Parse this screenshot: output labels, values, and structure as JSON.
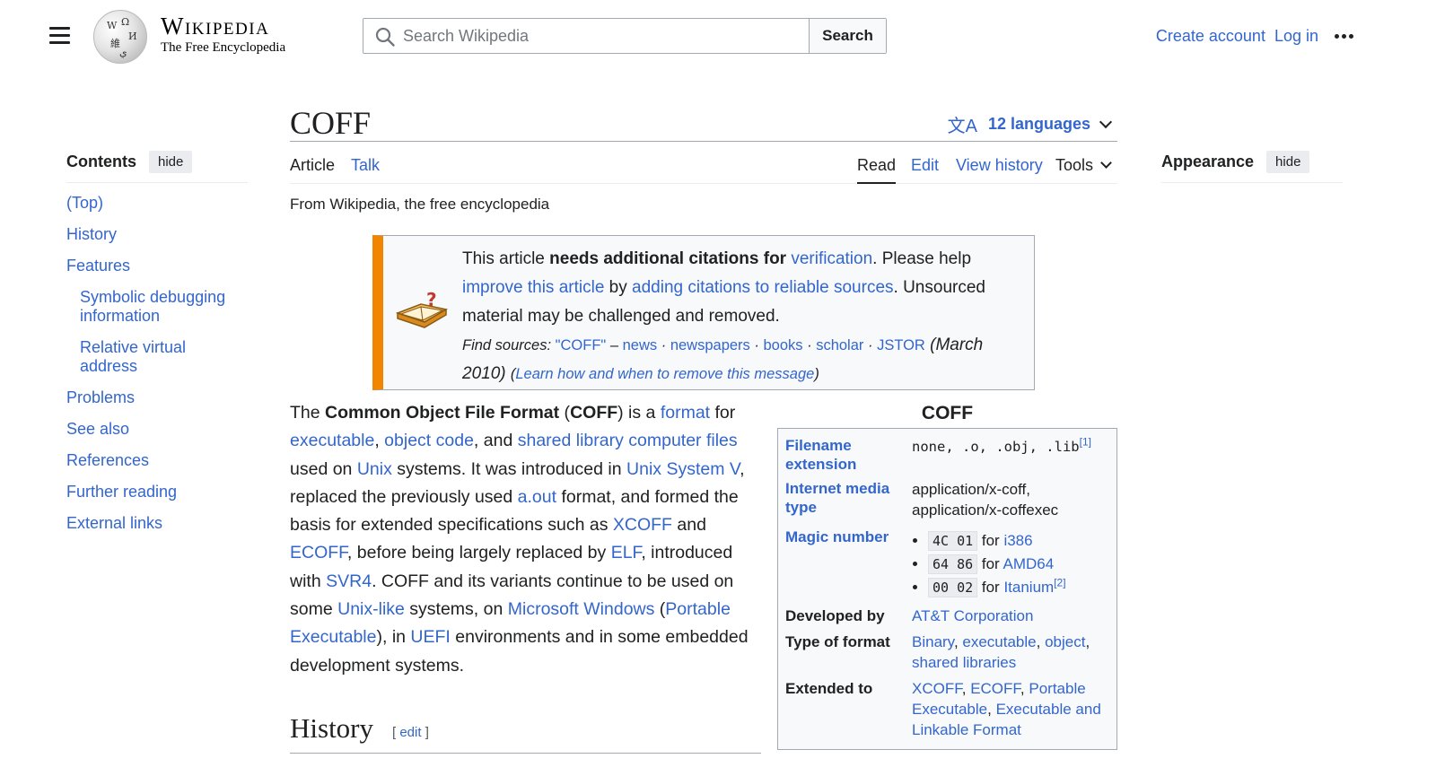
{
  "header": {
    "wordmark_title": "Wikipedia",
    "wordmark_tagline": "The Free Encyclopedia",
    "search_placeholder": "Search Wikipedia",
    "search_button": "Search",
    "create_account": "Create account",
    "log_in": "Log in"
  },
  "toc": {
    "title": "Contents",
    "hide_label": "hide",
    "items": [
      {
        "label": "(Top)"
      },
      {
        "label": "History"
      },
      {
        "label": "Features"
      },
      {
        "label": "Symbolic debugging information"
      },
      {
        "label": "Relative virtual address"
      },
      {
        "label": "Problems"
      },
      {
        "label": "See also"
      },
      {
        "label": "References"
      },
      {
        "label": "Further reading"
      },
      {
        "label": "External links"
      }
    ]
  },
  "page": {
    "title": "COFF",
    "languages": "12 languages",
    "tabs": {
      "article": "Article",
      "talk": "Talk",
      "read": "Read",
      "edit": "Edit",
      "history": "View history",
      "tools": "Tools"
    },
    "tagline": "From Wikipedia, the free encyclopedia"
  },
  "ambox": {
    "t1": "This article ",
    "t2": "needs additional citations for ",
    "t3": "verification",
    "t4": ". Please help ",
    "t5": "improve this article",
    "t6": " by ",
    "t7": "adding citations to reliable sources",
    "t8": ". Unsourced material may be challenged and removed.",
    "find_label": "Find sources:",
    "find_query": "\"COFF\"",
    "dash": " – ",
    "news": "news",
    "newspapers": "newspapers",
    "books": "books",
    "scholar": "scholar",
    "jstor": "JSTOR",
    "date": " (March 2010) ",
    "learn": "Learn how and when to remove this message"
  },
  "lead": {
    "p01": "The ",
    "p02": "Common Object File Format",
    "p03": " (",
    "p04": "COFF",
    "p05": ") is a ",
    "p06": "format",
    "p07": " for ",
    "p08": "executable",
    "p09": ", ",
    "p10": "object code",
    "p11": ", and ",
    "p12": "shared library computer files",
    "p13": " used on ",
    "p14": "Unix",
    "p15": " systems. It was introduced in ",
    "p16": "Unix System V",
    "p17": ", replaced the previously used ",
    "p18": "a.out",
    "p19": " format, and formed the basis for extended specifications such as ",
    "p20": "XCOFF",
    "p21": " and ",
    "p22": "ECOFF",
    "p23": ", before being largely replaced by ",
    "p24": "ELF",
    "p25": ", introduced with ",
    "p26": "SVR4",
    "p27": ". COFF and its variants continue to be used on some ",
    "p28": "Unix-like",
    "p29": " systems, on ",
    "p30": "Microsoft Windows",
    "p31": " (",
    "p32": "Portable Executable",
    "p33": "), in ",
    "p34": "UEFI",
    "p35": " environments and in some embedded development systems."
  },
  "section": {
    "title": "History",
    "edit_open": "[ ",
    "edit": "edit",
    "edit_close": " ]"
  },
  "infobox": {
    "title": "COFF",
    "filename_label": "Filename extension",
    "filename_value": "none, .o, .obj, .lib",
    "ref1": "[1]",
    "media_label": "Internet media type",
    "media_value1": "application/x-coff,",
    "media_value2": "application/x-coffexec",
    "magic_label": "Magic number",
    "magic": [
      {
        "code": "4C 01",
        "for": " for ",
        "arch": "i386",
        "ref": ""
      },
      {
        "code": "64 86",
        "for": " for ",
        "arch": "AMD64",
        "ref": ""
      },
      {
        "code": "00 02",
        "for": " for ",
        "arch": "Itanium",
        "ref": "[2]"
      }
    ],
    "dev_label": "Developed by",
    "dev_value": "AT&T Corporation",
    "type_label": "Type of format",
    "type_v1": "Binary",
    "type_v2": "executable",
    "type_v3": "object",
    "type_v4": "shared libraries",
    "ext_label": "Extended to",
    "ext_v1": "XCOFF",
    "ext_v2": "ECOFF",
    "ext_v3": "Portable Executable",
    "ext_v4": "Executable and Linkable Format",
    "comma": ", "
  },
  "appearance": {
    "title": "Appearance",
    "hide_label": "hide"
  },
  "colors": {
    "link": "#3366cc",
    "ambox_border": "#f28500",
    "text": "#202122"
  }
}
